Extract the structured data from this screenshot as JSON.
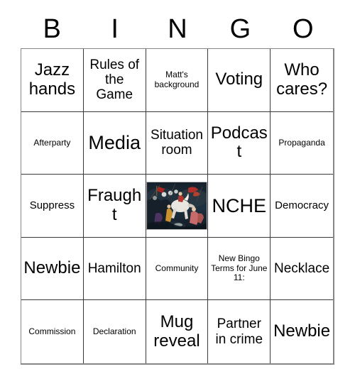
{
  "header": {
    "letters": [
      "B",
      "I",
      "N",
      "G",
      "O"
    ]
  },
  "grid": {
    "rows": [
      [
        {
          "text": "Jazz hands",
          "size": "lg"
        },
        {
          "text": "Rules of the Game",
          "size": "md"
        },
        {
          "text": "Matt's background",
          "size": "xs"
        },
        {
          "text": "Voting",
          "size": "lg"
        },
        {
          "text": "Who cares?",
          "size": "lg"
        }
      ],
      [
        {
          "text": "Afterparty",
          "size": "xs"
        },
        {
          "text": "Media",
          "size": "xl"
        },
        {
          "text": "Situation room",
          "size": "md"
        },
        {
          "text": "Podcast",
          "size": "lg"
        },
        {
          "text": "Propaganda",
          "size": "xs"
        }
      ],
      [
        {
          "text": "Suppress",
          "size": "sm"
        },
        {
          "text": "Fraught",
          "size": "lg"
        },
        {
          "text": "",
          "size": "md",
          "type": "image",
          "image_name": "battle-painting"
        },
        {
          "text": "NCHE",
          "size": "xl"
        },
        {
          "text": "Democracy",
          "size": "sm"
        }
      ],
      [
        {
          "text": "Newbie",
          "size": "lg"
        },
        {
          "text": "Hamilton",
          "size": "md"
        },
        {
          "text": "Community",
          "size": "xs"
        },
        {
          "text": "New Bingo Terms for June 11:",
          "size": "xs"
        },
        {
          "text": "Necklace",
          "size": "md"
        }
      ],
      [
        {
          "text": "Commission",
          "size": "xs"
        },
        {
          "text": "Declaration",
          "size": "xs"
        },
        {
          "text": "Mug reveal",
          "size": "lg"
        },
        {
          "text": "Partner in crime",
          "size": "md"
        },
        {
          "text": "Newbie",
          "size": "lg"
        }
      ]
    ]
  },
  "colors": {
    "background": "#ffffff",
    "text": "#000000",
    "cell_border": "#3a3a3a",
    "outer_border": "#868686",
    "image_dark": "#101c28",
    "image_banner_red": "#a8261f",
    "image_horse": "#e8e6e0",
    "image_accent_gold": "#c9922e"
  }
}
